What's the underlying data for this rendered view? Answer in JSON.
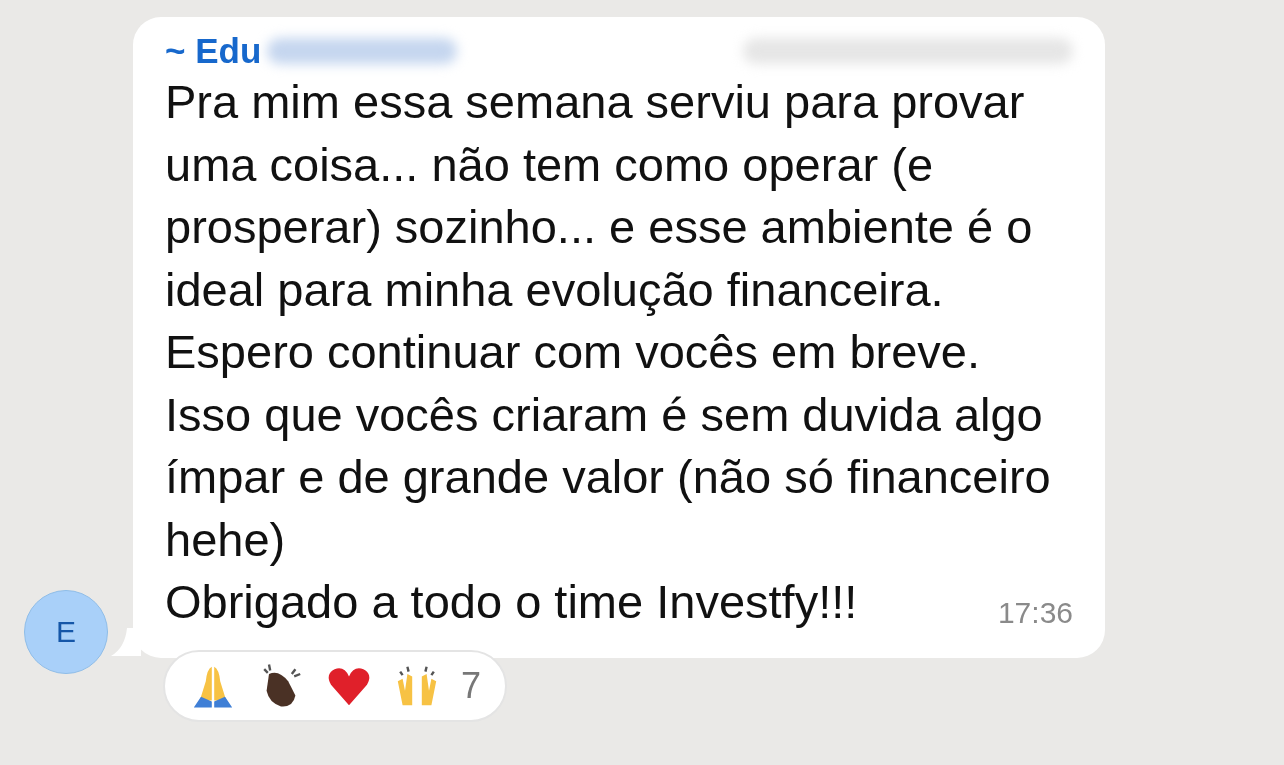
{
  "message": {
    "avatar_letter": "E",
    "sender": "~ Edu",
    "sender_redacted": true,
    "time_redacted": true,
    "paragraphs": [
      "Pra mim essa semana serviu para provar\numa coisa... não tem como operar (e\nprosperar) sozinho... e esse ambiente é o\nideal para minha evolução financeira.\nEspero continuar com vocês em breve.\nIsso que vocês criaram é sem duvida algo\nímpar e de grande valor (não só financeiro\nhehe)",
      "Obrigado a todo o time Investfy!!!"
    ],
    "time": "17:36",
    "reactions": [
      {
        "kind": "pray"
      },
      {
        "kind": "clap"
      },
      {
        "kind": "heart"
      },
      {
        "kind": "raised"
      }
    ],
    "reaction_count": "7"
  }
}
